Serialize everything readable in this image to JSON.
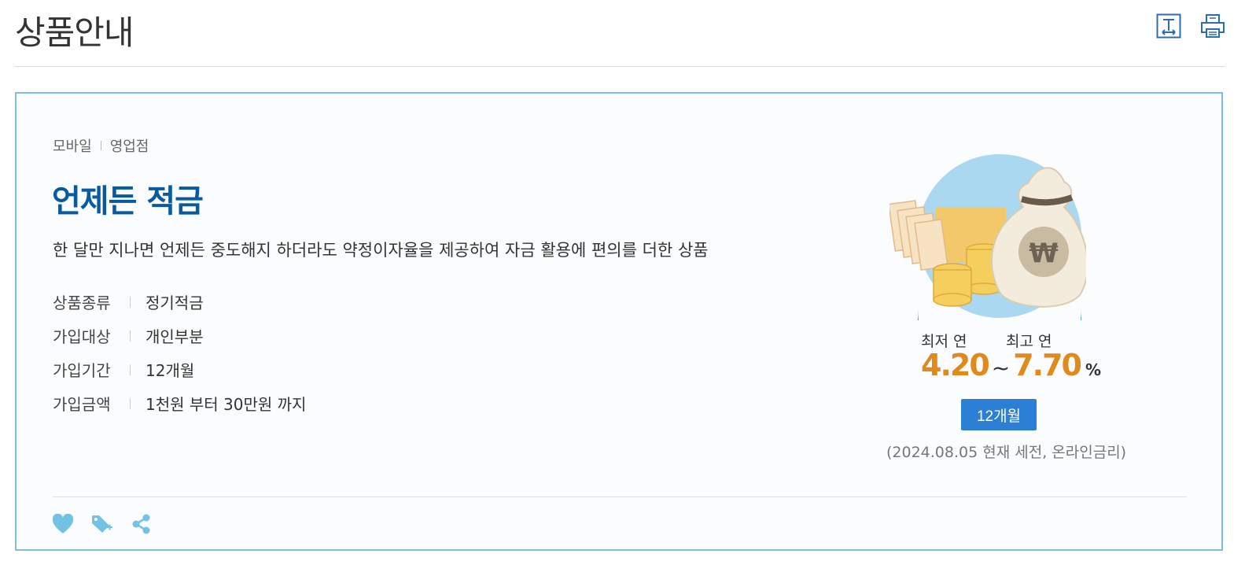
{
  "page": {
    "title": "상품안내"
  },
  "header": {
    "tools": [
      "text-size-icon",
      "print-icon"
    ]
  },
  "product": {
    "channels": [
      "모바일",
      "영업점"
    ],
    "name": "언제든 적금",
    "description": "한 달만 지나면 언제든 중도해지 하더라도 약정이자율을 제공하여 자금 활용에 편의를 더한 상품",
    "info": [
      {
        "label": "상품종류",
        "value": "정기적금"
      },
      {
        "label": "가입대상",
        "value": "개인부분"
      },
      {
        "label": "가입기간",
        "value": "12개월"
      },
      {
        "label": "가입금액",
        "value": "1천원 부터 30만원 까지"
      }
    ]
  },
  "rate": {
    "min_label": "최저 연",
    "max_label": "최고 연",
    "min": "4.20",
    "separator": "~",
    "max": "7.70",
    "unit": "%",
    "term_button": "12개월",
    "note": "(2024.08.05 현재 세전, 온라인금리)"
  },
  "actions": [
    "heart-icon",
    "tag-add-icon",
    "share-icon"
  ],
  "colors": {
    "accent": "#2b7fd4",
    "title": "#0a5aa0",
    "rate": "#e08a1e",
    "border": "#7ec0db"
  }
}
